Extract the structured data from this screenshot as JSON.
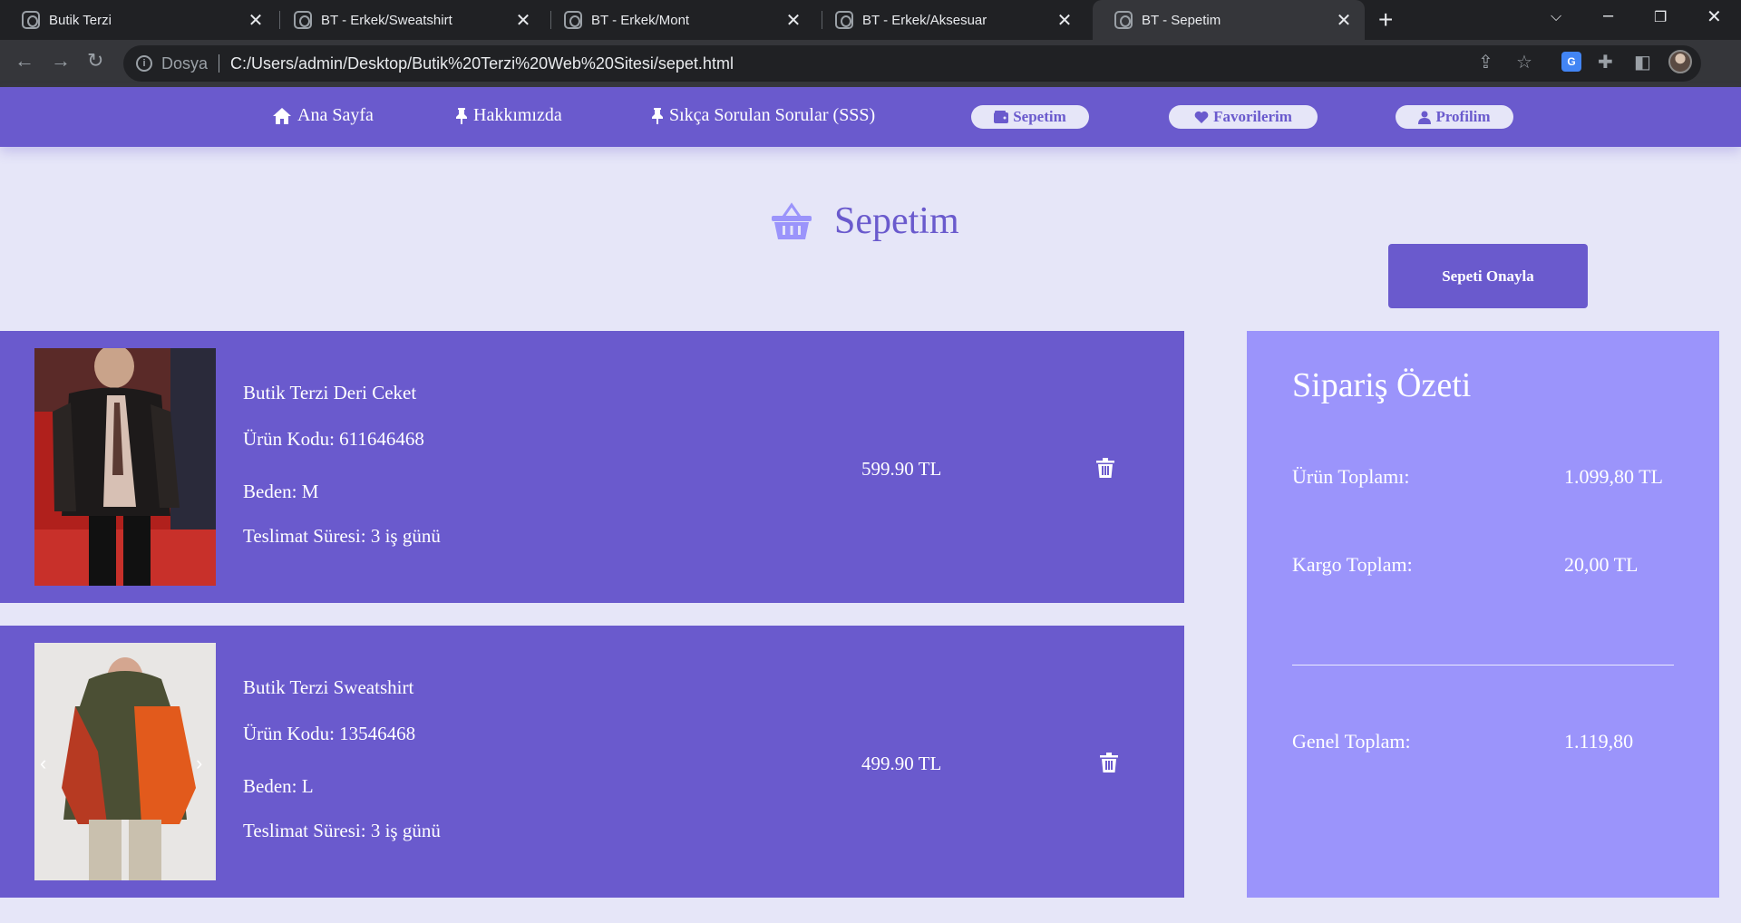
{
  "browser": {
    "tabs": [
      {
        "title": "Butik Terzi",
        "active": false
      },
      {
        "title": "BT - Erkek/Sweatshirt",
        "active": false
      },
      {
        "title": "BT - Erkek/Mont",
        "active": false
      },
      {
        "title": "BT - Erkek/Aksesuar",
        "active": false
      },
      {
        "title": "BT - Sepetim",
        "active": true
      }
    ],
    "address": {
      "scheme_label": "Dosya",
      "url": "C:/Users/admin/Desktop/Butik%20Terzi%20Web%20Sitesi/sepet.html"
    }
  },
  "nav": {
    "links": [
      {
        "label": "Ana Sayfa",
        "icon": "home-icon"
      },
      {
        "label": "Hakkımızda",
        "icon": "pin-icon"
      },
      {
        "label": "Sıkça Sorulan Sorular (SSS)",
        "icon": "pin-icon"
      }
    ],
    "pills": [
      {
        "label": "Sepetim",
        "icon": "wallet-icon"
      },
      {
        "label": "Favorilerim",
        "icon": "heart-icon"
      },
      {
        "label": "Profilim",
        "icon": "user-icon"
      }
    ]
  },
  "page": {
    "title": "Sepetim",
    "title_icon": "basket-icon",
    "confirm_button": "Sepeti Onayla"
  },
  "cart": {
    "items": [
      {
        "name": "Butik Terzi Deri Ceket",
        "code": "Ürün Kodu: 611646468",
        "size": "Beden: M",
        "delivery": "Teslimat Süresi: 3 iş günü",
        "price": "599.90 TL"
      },
      {
        "name": "Butik Terzi Sweatshirt",
        "code": "Ürün Kodu: 13546468",
        "size": "Beden: L",
        "delivery": "Teslimat Süresi: 3 iş günü",
        "price": "499.90 TL"
      }
    ]
  },
  "summary": {
    "title": "Sipariş Özeti",
    "product_total_label": "Ürün Toplamı:",
    "product_total_value": "1.099,80 TL",
    "shipping_label": "Kargo Toplam:",
    "shipping_value": "20,00 TL",
    "grand_total_label": "Genel Toplam:",
    "grand_total_value": "1.119,80"
  },
  "colors": {
    "primary": "#6a5acd",
    "summary_bg": "#9b94fb",
    "page_bg": "#e6e6f8"
  }
}
